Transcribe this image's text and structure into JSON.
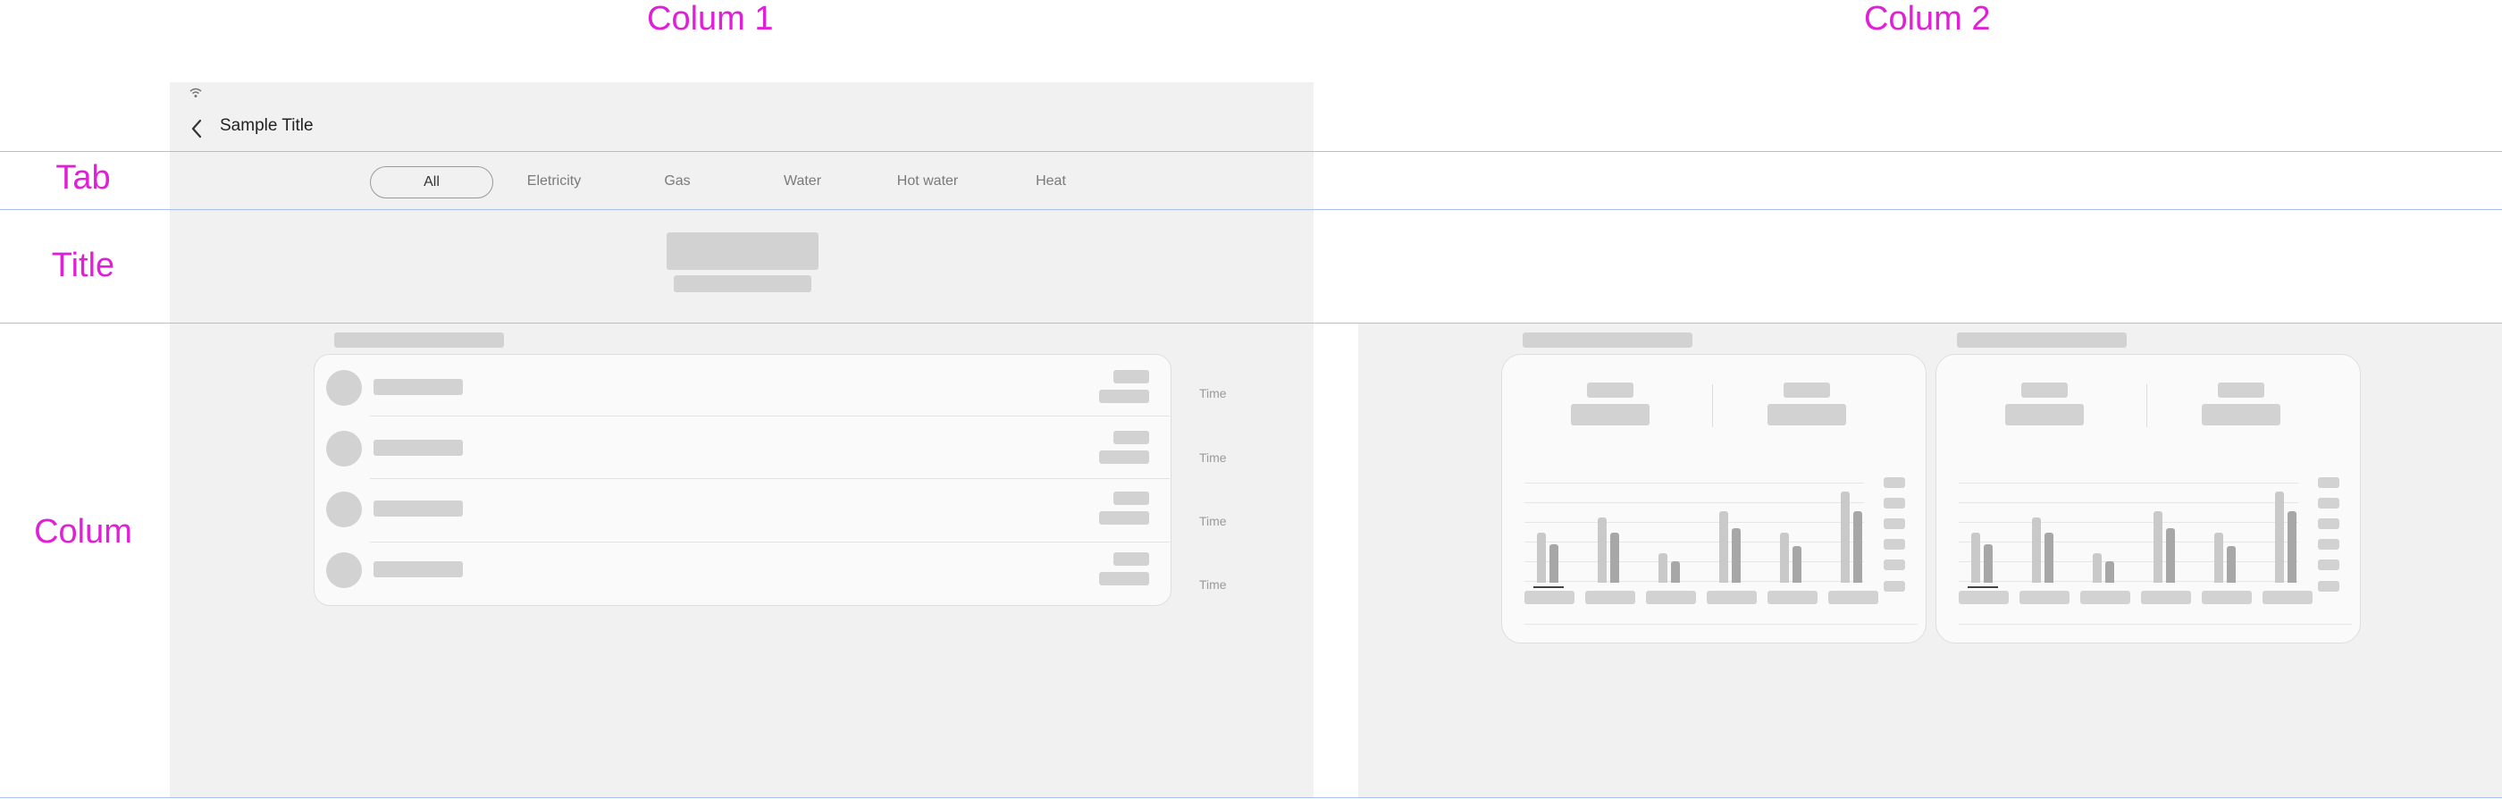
{
  "annotations": {
    "column1": "Colum 1",
    "column2": "Colum 2",
    "tab": "Tab",
    "title": "Title",
    "column": "Colum"
  },
  "header": {
    "title": "Sample Title",
    "back_icon": "chevron-left-icon",
    "status_icon": "wifi-icon"
  },
  "tabs": [
    {
      "label": "All",
      "active": true
    },
    {
      "label": "Eletricity",
      "active": false
    },
    {
      "label": "Gas",
      "active": false
    },
    {
      "label": "Water",
      "active": false
    },
    {
      "label": "Hot water",
      "active": false
    },
    {
      "label": "Heat",
      "active": false
    }
  ],
  "list": {
    "rows": [
      {
        "time": "Time"
      },
      {
        "time": "Time"
      },
      {
        "time": "Time"
      },
      {
        "time": "Time"
      }
    ]
  },
  "colors": {
    "annotation": "#e020d6",
    "guide_line": "#a9c0ec",
    "panel_bg": "#f1f1f1",
    "skeleton": "#d2d2d2"
  },
  "charts": [
    {
      "bars": [
        {
          "a": 0.55,
          "b": 0.42
        },
        {
          "a": 0.72,
          "b": 0.55
        },
        {
          "a": 0.32,
          "b": 0.24
        },
        {
          "a": 0.78,
          "b": 0.6
        },
        {
          "a": 0.55,
          "b": 0.4
        },
        {
          "a": 1.0,
          "b": 0.78
        }
      ]
    },
    {
      "bars": [
        {
          "a": 0.55,
          "b": 0.42
        },
        {
          "a": 0.72,
          "b": 0.55
        },
        {
          "a": 0.32,
          "b": 0.24
        },
        {
          "a": 0.78,
          "b": 0.6
        },
        {
          "a": 0.55,
          "b": 0.4
        },
        {
          "a": 1.0,
          "b": 0.78
        }
      ]
    }
  ]
}
